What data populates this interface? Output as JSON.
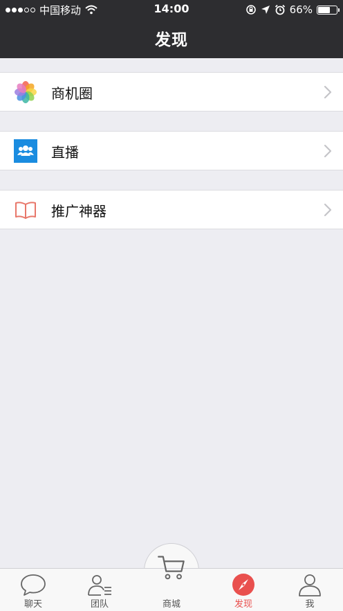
{
  "status_bar": {
    "carrier": "中国移动",
    "time": "14:00",
    "battery": "66%",
    "battery_level": 0.66
  },
  "nav": {
    "title": "发现"
  },
  "menu": [
    {
      "label": "商机圈",
      "icon": "flower-pinwheel-icon"
    },
    {
      "label": "直播",
      "icon": "people-group-icon"
    },
    {
      "label": "推广神器",
      "icon": "open-book-icon"
    }
  ],
  "tabs": [
    {
      "label": "聊天",
      "icon": "chat-bubble-icon",
      "active": false
    },
    {
      "label": "团队",
      "icon": "team-list-icon",
      "active": false
    },
    {
      "label": "商城",
      "icon": "shopping-cart-icon",
      "active": false
    },
    {
      "label": "发现",
      "icon": "compass-icon",
      "active": true
    },
    {
      "label": "我",
      "icon": "user-profile-icon",
      "active": false
    }
  ],
  "colors": {
    "header_bg": "#2d2d30",
    "page_bg": "#ededf2",
    "accent": "#e9504e",
    "live_blue": "#1a8ce0",
    "book_red": "#e8776a"
  }
}
